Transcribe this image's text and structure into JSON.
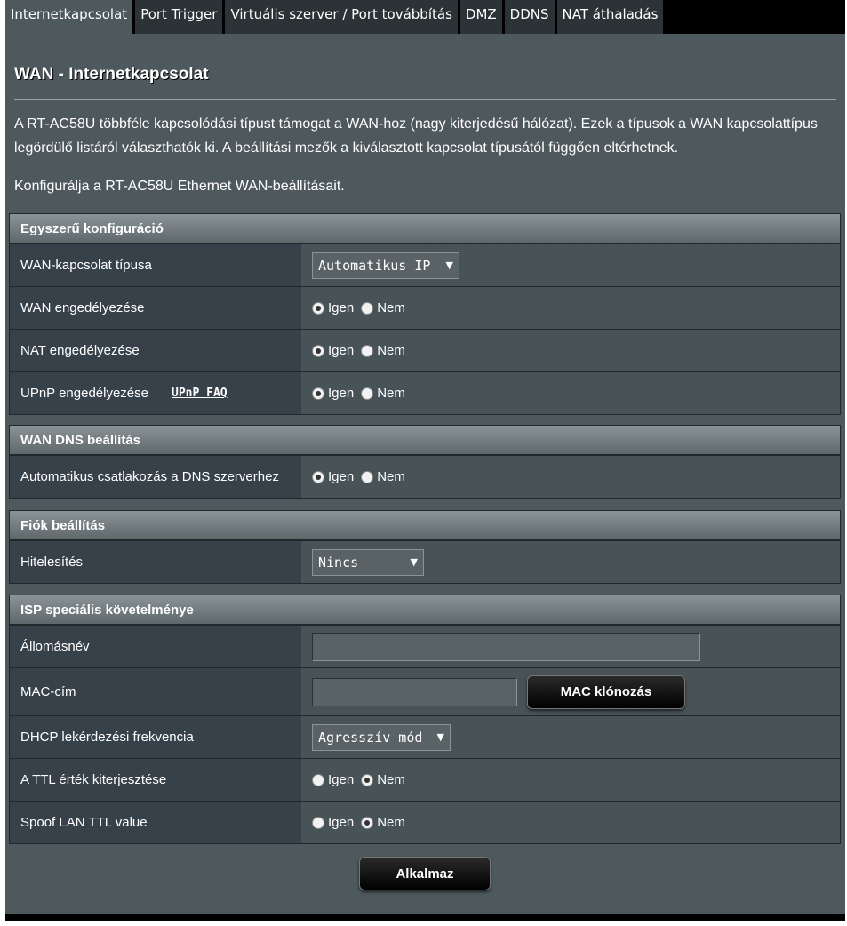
{
  "tabs": [
    "Internetkapcsolat",
    "Port Trigger",
    "Virtuális szerver / Port továbbítás",
    "DMZ",
    "DDNS",
    "NAT áthaladás"
  ],
  "page": {
    "title": "WAN - Internetkapcsolat",
    "description": "A RT-AC58U többféle kapcsolódási típust támogat a WAN-hoz (nagy kiterjedésű hálózat). Ezek a típusok a WAN kapcsolattípus legördülő listáról választhatók ki. A beállítási mezők a kiválasztott kapcsolat típusától függően eltérhetnek.",
    "description2": "Konfigurálja a RT-AC58U Ethernet WAN-beállításait."
  },
  "radio": {
    "yes": "Igen",
    "no": "Nem"
  },
  "basic": {
    "header": "Egyszerű konfiguráció",
    "wan_type_label": "WAN-kapcsolat típusa",
    "wan_type_value": "Automatikus IP",
    "wan_enable_label": "WAN engedélyezése",
    "nat_enable_label": "NAT engedélyezése",
    "upnp_enable_label": "UPnP engedélyezése",
    "upnp_faq": "UPnP FAQ"
  },
  "dns": {
    "header": "WAN DNS beállítás",
    "auto_dns_label": "Automatikus csatlakozás a DNS szerverhez"
  },
  "account": {
    "header": "Fiók beállítás",
    "auth_label": "Hitelesítés",
    "auth_value": "Nincs"
  },
  "isp": {
    "header": "ISP speciális követelménye",
    "hostname_label": "Állomásnév",
    "hostname_value": "",
    "mac_label": "MAC-cím",
    "mac_value": "",
    "mac_clone_button": "MAC klónozás",
    "dhcp_label": "DHCP lekérdezési frekvencia",
    "dhcp_value": "Agresszív mód",
    "ttl_label": "A TTL érték kiterjesztése",
    "spoof_label": "Spoof LAN TTL value"
  },
  "apply_button": "Alkalmaz",
  "selections": {
    "wan_enable": "yes",
    "nat_enable": "yes",
    "upnp_enable": "yes",
    "auto_dns": "yes",
    "ttl_extend": "no",
    "spoof_ttl": "no"
  }
}
